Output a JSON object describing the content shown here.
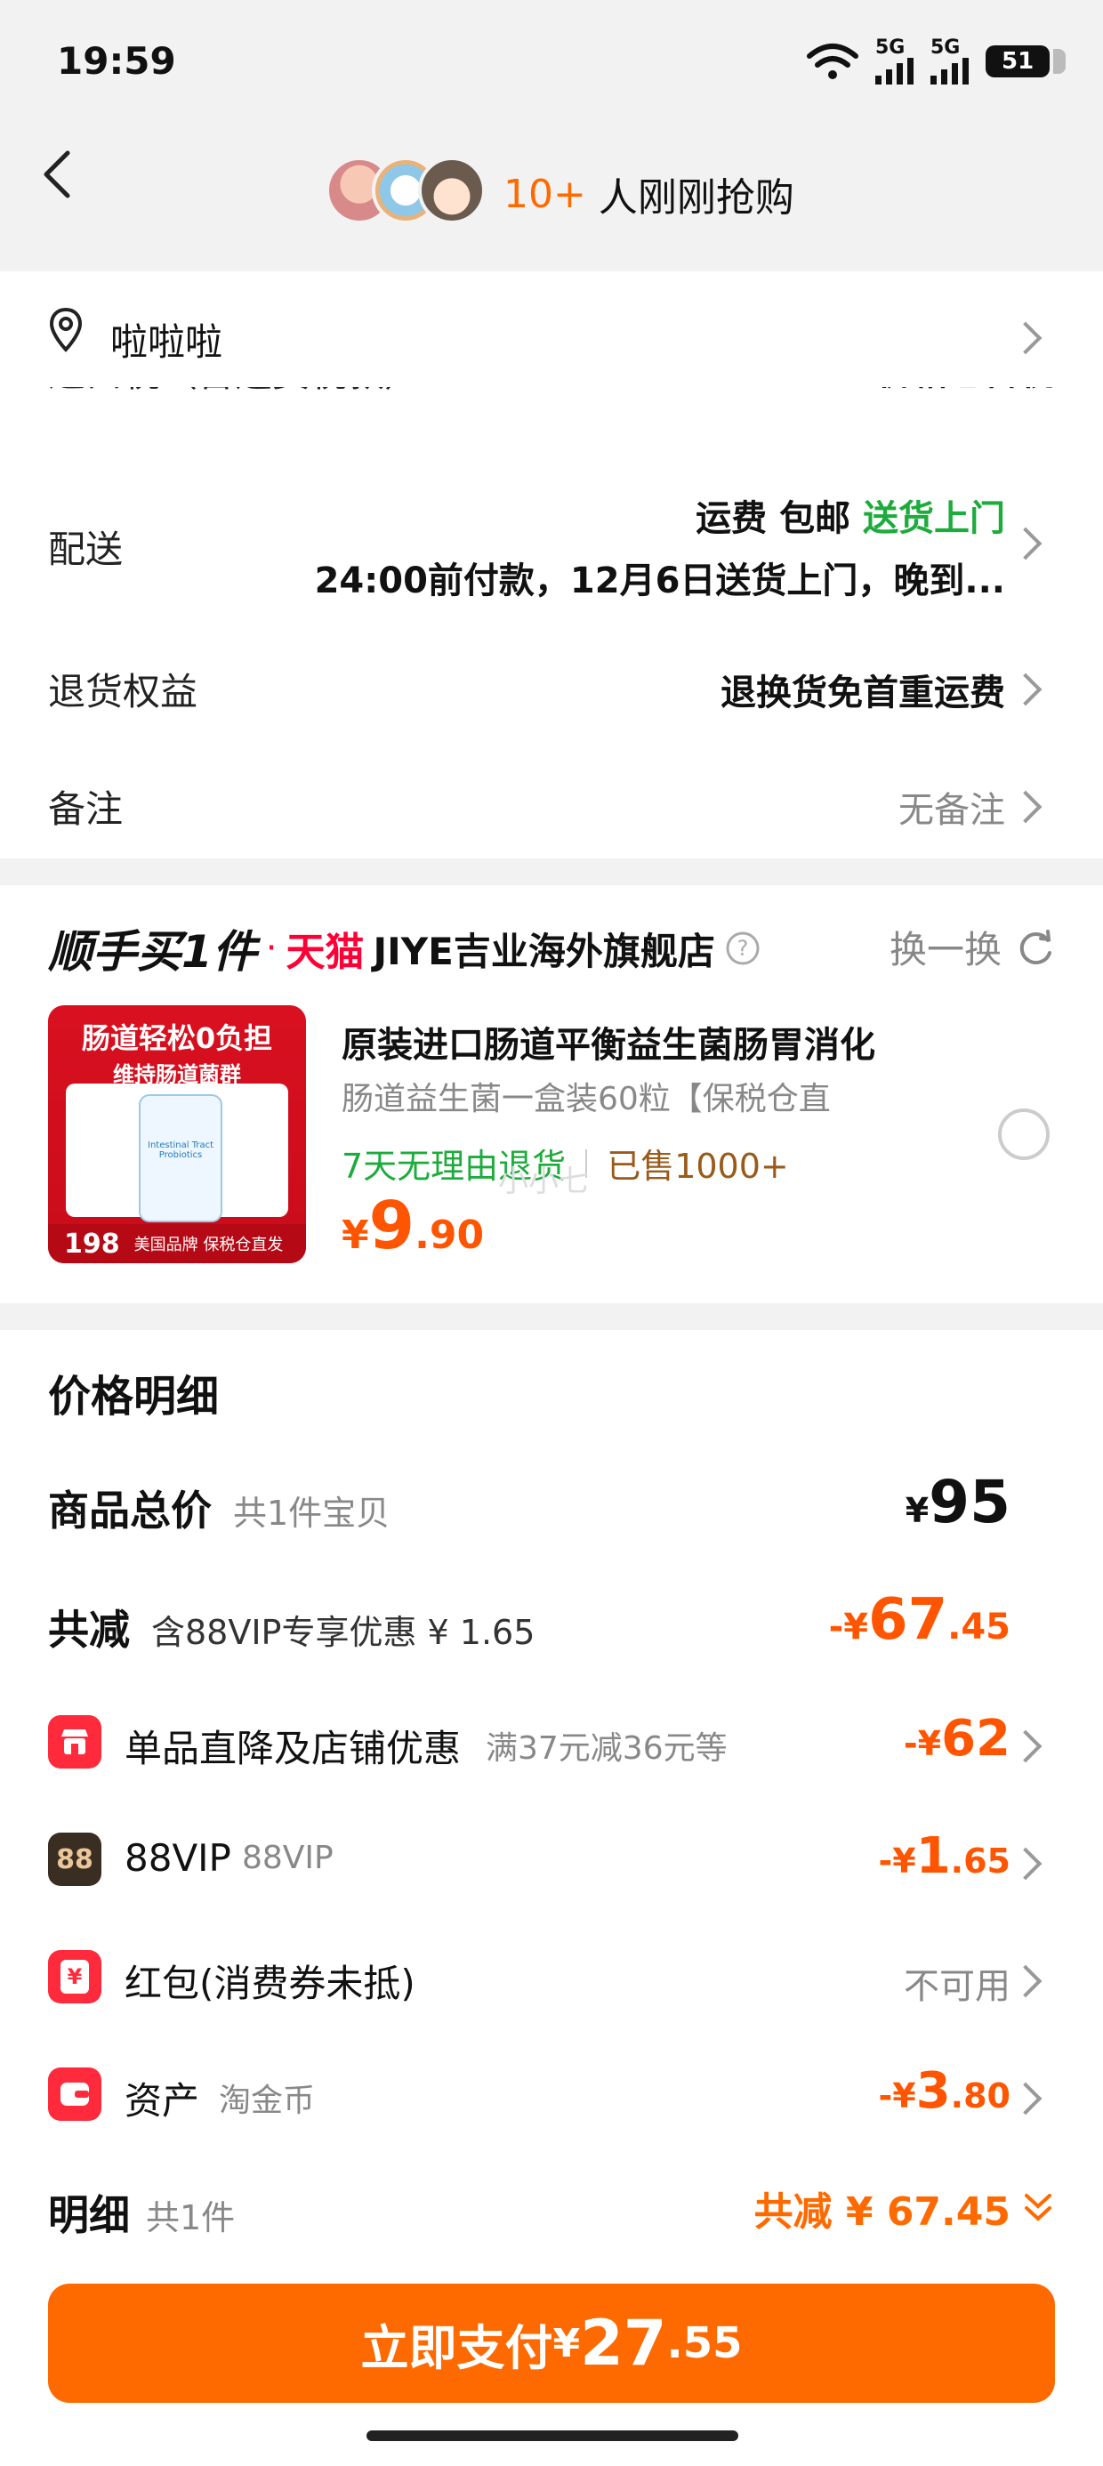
{
  "status_bar": {
    "time": "19:59",
    "signal1": "5G",
    "signal2": "5G",
    "battery": "51"
  },
  "header": {
    "buyer_count": "10+",
    "buyer_text": "人刚刚抢购"
  },
  "address": {
    "name": "啦啦啦"
  },
  "partial_row": {
    "label": "进口税（含运费税款）",
    "value": "价格已含税"
  },
  "delivery": {
    "label": "配送",
    "fee_label": "运费",
    "fee_value": "包邮",
    "method": "送货上门",
    "detail": "24:00前付款，12月6日送货上门，晚到..."
  },
  "returns": {
    "label": "退货权益",
    "value": "退换货免首重运费"
  },
  "note": {
    "label": "备注",
    "value": "无备注"
  },
  "addon": {
    "title": "顺手买1件",
    "platform": "天猫",
    "shop": "JIYE吉业海外旗舰店",
    "help_icon": "help-circle-icon",
    "refresh": "换一换",
    "product": {
      "image_headline": "肠道轻松0负担",
      "image_subline": "维持肠道菌群",
      "image_price": "198",
      "image_footer": "美国品牌 保税仓直发",
      "bottle_label": "Intestinal Tract Probiotics",
      "title": "原装进口肠道平衡益生菌肠胃消化",
      "subtitle": "肠道益生菌一盒装60粒【保税仓直",
      "tag1": "7天无理由退货",
      "tag2": "已售1000+",
      "price_symbol": "¥",
      "price_int": "9",
      "price_dec": ".90",
      "watermark": "小小七"
    }
  },
  "price": {
    "title": "价格明细",
    "total_label": "商品总价",
    "total_count": "共1件宝贝",
    "total_symbol": "¥",
    "total_value": "95",
    "reduce_label": "共减",
    "reduce_note": "含88VIP专享优惠 ¥ 1.65",
    "reduce_prefix": "-¥",
    "reduce_int": "67",
    "reduce_dec": ".45",
    "items": [
      {
        "icon": "store-icon",
        "icon_color": "#ff2a3c",
        "label": "单品直降及店铺优惠",
        "note": "满37元减36元等",
        "prefix": "-¥",
        "int": "62",
        "dec": ""
      },
      {
        "icon": "vip88-icon",
        "icon_glyph": "88",
        "icon_color": "#3a2d22",
        "label": "88VIP",
        "note": "88VIP",
        "prefix": "-¥",
        "int": "1",
        "dec": ".65"
      },
      {
        "icon": "red-packet-icon",
        "icon_glyph": "¥",
        "icon_color": "#ff2a3c",
        "label": "红包(消费券未抵)",
        "note": "",
        "status": "不可用"
      },
      {
        "icon": "coin-icon",
        "icon_color": "#ff2a3c",
        "label": "资产",
        "note": "淘金币",
        "prefix": "-¥",
        "int": "3",
        "dec": ".80"
      }
    ],
    "detail_label": "明细",
    "detail_count": "共1件",
    "detail_total": "共减 ¥ 67.45"
  },
  "pay": {
    "label": "立即支付",
    "symbol": "¥",
    "int": "27",
    "dec": ".55"
  },
  "colors": {
    "accent": "#ff6a00",
    "price": "#ff5500",
    "green": "#1dab3c",
    "tmall_red": "#ff0036"
  }
}
